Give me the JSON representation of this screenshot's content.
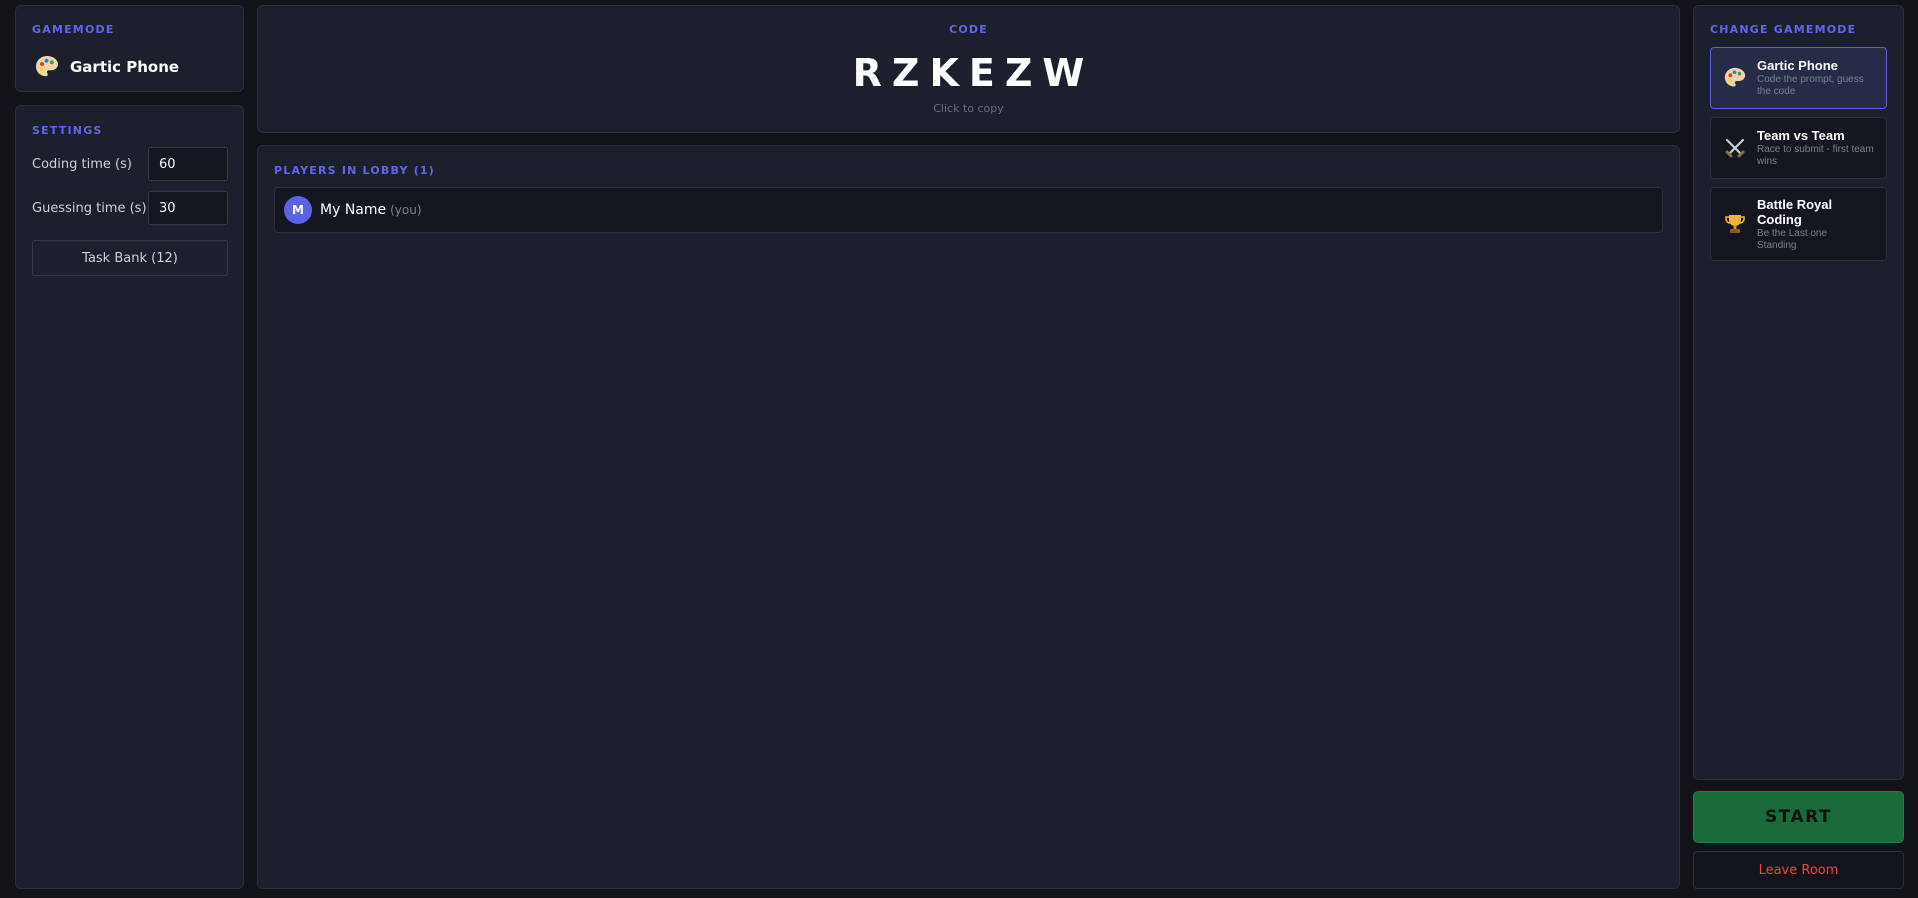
{
  "gamemode": {
    "label": "GAMEMODE",
    "current_name": "Gartic Phone",
    "current_icon": "palette-icon"
  },
  "settings": {
    "label": "SETTINGS",
    "coding_time_label": "Coding time (s)",
    "coding_time_value": "60",
    "guessing_time_label": "Guessing time (s)",
    "guessing_time_value": "30",
    "task_bank_label": "Task Bank (12)"
  },
  "room": {
    "label": "CODE",
    "code": "RZKEZW",
    "copy_hint": "Click to copy"
  },
  "lobby": {
    "label": "PLAYERS IN LOBBY (1)",
    "players": [
      {
        "initial": "M",
        "name": "My Name",
        "tag": "(you)"
      }
    ]
  },
  "change_gamemode": {
    "label": "CHANGE GAMEMODE",
    "modes": [
      {
        "title": "Gartic Phone",
        "desc": "Code the prompt, guess the code",
        "icon": "palette-icon",
        "active": true
      },
      {
        "title": "Team vs Team",
        "desc": "Race to submit - first team wins",
        "icon": "crossed-swords-icon",
        "active": false
      },
      {
        "title": "Battle Royal Coding",
        "desc": "Be the Last one Standing",
        "icon": "trophy-icon",
        "active": false
      }
    ]
  },
  "actions": {
    "start_label": "START",
    "leave_label": "Leave Room"
  },
  "colors": {
    "accent": "#6166f0",
    "start": "#1a6a3a",
    "leave": "#ef4444",
    "background": "#111319",
    "panel": "#1c1f2c"
  }
}
